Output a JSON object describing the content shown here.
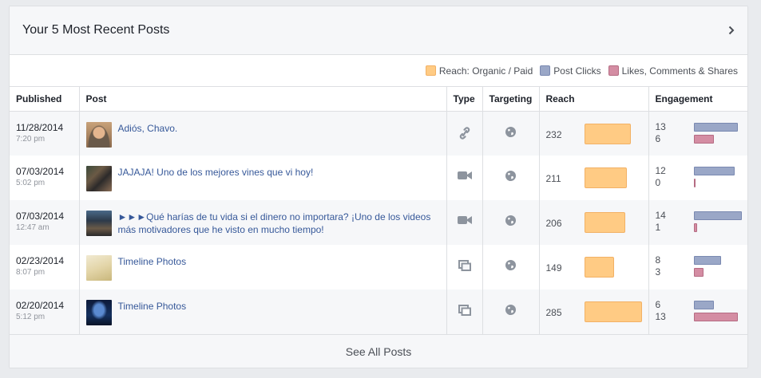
{
  "card": {
    "title": "Your 5 Most Recent Posts",
    "footer_link": "See All Posts"
  },
  "legend": [
    {
      "label": "Reach: Organic / Paid",
      "color": "#ffcb84"
    },
    {
      "label": "Post Clicks",
      "color": "#9aa7c7"
    },
    {
      "label": "Likes, Comments & Shares",
      "color": "#d48da3"
    }
  ],
  "columns": {
    "published": "Published",
    "post": "Post",
    "type": "Type",
    "targeting": "Targeting",
    "reach": "Reach",
    "engagement": "Engagement"
  },
  "posts": [
    {
      "date": "11/28/2014",
      "time": "7:20 pm",
      "text": "Adiós, Chavo.",
      "type_icon": "link-icon",
      "targeting_icon": "globe-icon",
      "reach": "232",
      "clicks": "13",
      "likes": "6"
    },
    {
      "date": "07/03/2014",
      "time": "5:02 pm",
      "text": "JAJAJA! Uno de los mejores vines que vi hoy!",
      "type_icon": "video-icon",
      "targeting_icon": "globe-icon",
      "reach": "211",
      "clicks": "12",
      "likes": "0"
    },
    {
      "date": "07/03/2014",
      "time": "12:47 am",
      "text": "►►►Qué harías de tu vida si el dinero no importara? ¡Uno de los videos más motivadores que he visto en mucho tiempo!",
      "type_icon": "video-icon",
      "targeting_icon": "globe-icon",
      "reach": "206",
      "clicks": "14",
      "likes": "1"
    },
    {
      "date": "02/23/2014",
      "time": "8:07 pm",
      "text": "Timeline Photos",
      "type_icon": "photo-album-icon",
      "targeting_icon": "globe-icon",
      "reach": "149",
      "clicks": "8",
      "likes": "3"
    },
    {
      "date": "02/20/2014",
      "time": "5:12 pm",
      "text": "Timeline Photos",
      "type_icon": "photo-album-icon",
      "targeting_icon": "globe-icon",
      "reach": "285",
      "clicks": "6",
      "likes": "13"
    }
  ]
}
